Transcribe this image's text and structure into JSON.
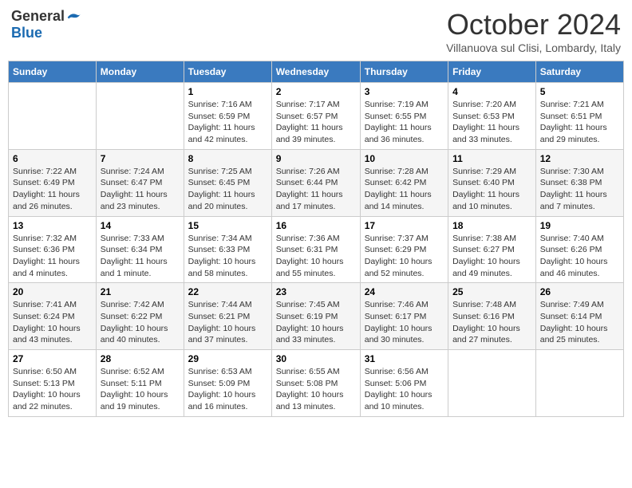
{
  "header": {
    "logo_general": "General",
    "logo_blue": "Blue",
    "month": "October 2024",
    "location": "Villanuova sul Clisi, Lombardy, Italy"
  },
  "days_of_week": [
    "Sunday",
    "Monday",
    "Tuesday",
    "Wednesday",
    "Thursday",
    "Friday",
    "Saturday"
  ],
  "weeks": [
    [
      {
        "day": "",
        "info": ""
      },
      {
        "day": "",
        "info": ""
      },
      {
        "day": "1",
        "sunrise": "7:16 AM",
        "sunset": "6:59 PM",
        "daylight": "11 hours and 42 minutes."
      },
      {
        "day": "2",
        "sunrise": "7:17 AM",
        "sunset": "6:57 PM",
        "daylight": "11 hours and 39 minutes."
      },
      {
        "day": "3",
        "sunrise": "7:19 AM",
        "sunset": "6:55 PM",
        "daylight": "11 hours and 36 minutes."
      },
      {
        "day": "4",
        "sunrise": "7:20 AM",
        "sunset": "6:53 PM",
        "daylight": "11 hours and 33 minutes."
      },
      {
        "day": "5",
        "sunrise": "7:21 AM",
        "sunset": "6:51 PM",
        "daylight": "11 hours and 29 minutes."
      }
    ],
    [
      {
        "day": "6",
        "sunrise": "7:22 AM",
        "sunset": "6:49 PM",
        "daylight": "11 hours and 26 minutes."
      },
      {
        "day": "7",
        "sunrise": "7:24 AM",
        "sunset": "6:47 PM",
        "daylight": "11 hours and 23 minutes."
      },
      {
        "day": "8",
        "sunrise": "7:25 AM",
        "sunset": "6:45 PM",
        "daylight": "11 hours and 20 minutes."
      },
      {
        "day": "9",
        "sunrise": "7:26 AM",
        "sunset": "6:44 PM",
        "daylight": "11 hours and 17 minutes."
      },
      {
        "day": "10",
        "sunrise": "7:28 AM",
        "sunset": "6:42 PM",
        "daylight": "11 hours and 14 minutes."
      },
      {
        "day": "11",
        "sunrise": "7:29 AM",
        "sunset": "6:40 PM",
        "daylight": "11 hours and 10 minutes."
      },
      {
        "day": "12",
        "sunrise": "7:30 AM",
        "sunset": "6:38 PM",
        "daylight": "11 hours and 7 minutes."
      }
    ],
    [
      {
        "day": "13",
        "sunrise": "7:32 AM",
        "sunset": "6:36 PM",
        "daylight": "11 hours and 4 minutes."
      },
      {
        "day": "14",
        "sunrise": "7:33 AM",
        "sunset": "6:34 PM",
        "daylight": "11 hours and 1 minute."
      },
      {
        "day": "15",
        "sunrise": "7:34 AM",
        "sunset": "6:33 PM",
        "daylight": "10 hours and 58 minutes."
      },
      {
        "day": "16",
        "sunrise": "7:36 AM",
        "sunset": "6:31 PM",
        "daylight": "10 hours and 55 minutes."
      },
      {
        "day": "17",
        "sunrise": "7:37 AM",
        "sunset": "6:29 PM",
        "daylight": "10 hours and 52 minutes."
      },
      {
        "day": "18",
        "sunrise": "7:38 AM",
        "sunset": "6:27 PM",
        "daylight": "10 hours and 49 minutes."
      },
      {
        "day": "19",
        "sunrise": "7:40 AM",
        "sunset": "6:26 PM",
        "daylight": "10 hours and 46 minutes."
      }
    ],
    [
      {
        "day": "20",
        "sunrise": "7:41 AM",
        "sunset": "6:24 PM",
        "daylight": "10 hours and 43 minutes."
      },
      {
        "day": "21",
        "sunrise": "7:42 AM",
        "sunset": "6:22 PM",
        "daylight": "10 hours and 40 minutes."
      },
      {
        "day": "22",
        "sunrise": "7:44 AM",
        "sunset": "6:21 PM",
        "daylight": "10 hours and 37 minutes."
      },
      {
        "day": "23",
        "sunrise": "7:45 AM",
        "sunset": "6:19 PM",
        "daylight": "10 hours and 33 minutes."
      },
      {
        "day": "24",
        "sunrise": "7:46 AM",
        "sunset": "6:17 PM",
        "daylight": "10 hours and 30 minutes."
      },
      {
        "day": "25",
        "sunrise": "7:48 AM",
        "sunset": "6:16 PM",
        "daylight": "10 hours and 27 minutes."
      },
      {
        "day": "26",
        "sunrise": "7:49 AM",
        "sunset": "6:14 PM",
        "daylight": "10 hours and 25 minutes."
      }
    ],
    [
      {
        "day": "27",
        "sunrise": "6:50 AM",
        "sunset": "5:13 PM",
        "daylight": "10 hours and 22 minutes."
      },
      {
        "day": "28",
        "sunrise": "6:52 AM",
        "sunset": "5:11 PM",
        "daylight": "10 hours and 19 minutes."
      },
      {
        "day": "29",
        "sunrise": "6:53 AM",
        "sunset": "5:09 PM",
        "daylight": "10 hours and 16 minutes."
      },
      {
        "day": "30",
        "sunrise": "6:55 AM",
        "sunset": "5:08 PM",
        "daylight": "10 hours and 13 minutes."
      },
      {
        "day": "31",
        "sunrise": "6:56 AM",
        "sunset": "5:06 PM",
        "daylight": "10 hours and 10 minutes."
      },
      {
        "day": "",
        "info": ""
      },
      {
        "day": "",
        "info": ""
      }
    ]
  ],
  "labels": {
    "sunrise": "Sunrise:",
    "sunset": "Sunset:",
    "daylight": "Daylight:"
  }
}
